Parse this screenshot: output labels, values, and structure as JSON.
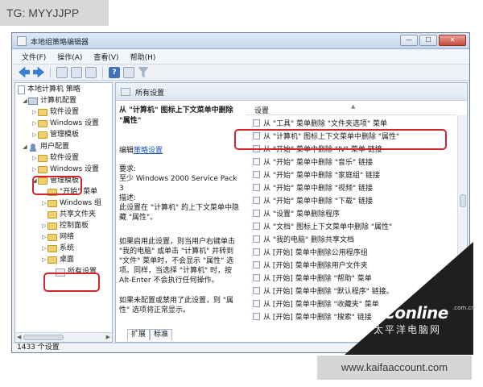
{
  "overlay": {
    "tag_text": "TG: MYYJJPP",
    "footer_url": "www.kaifaaccount.com",
    "watermark_main": "PConline",
    "watermark_com": ".com.cn",
    "watermark_cn": "太平洋电脑网"
  },
  "window": {
    "title": "本地组策略编辑器",
    "min_symbol": "—",
    "max_symbol": "☐",
    "close_symbol": "✕"
  },
  "menu": [
    "文件(F)",
    "操作(A)",
    "查看(V)",
    "帮助(H)"
  ],
  "tree": {
    "root": "本地计算机 策略",
    "computer_config": "计算机配置",
    "cc_software": "软件设置",
    "cc_windows": "Windows 设置",
    "cc_admin": "管理模板",
    "user_config": "用户配置",
    "uc_software": "软件设置",
    "uc_windows": "Windows 设置",
    "uc_admin": "管理模板",
    "sub_start": "\"开始\" 菜单",
    "sub_windows": "Windows 组",
    "sub_shared": "共享文件夹",
    "sub_control": "控制面板",
    "sub_network": "网络",
    "sub_system": "系统",
    "sub_desktop": "桌面",
    "sub_all": "所有设置",
    "expand_open": "◢",
    "expand_closed": "▷"
  },
  "right_header": "所有设置",
  "description": {
    "title": "从 \"计算机\" 图标上下文菜单中删除 \"属性\"",
    "edit_prefix": "编辑",
    "edit_link": "策略设置",
    "requirement": "要求:\n至少 Windows 2000 Service Pack 3",
    "desc_label": "描述:",
    "desc_text": "此设置在 \"计算机\" 的上下文菜单中隐藏 \"属性\"。",
    "para1": "如果启用此设置，则当用户右键单击 \"我的电脑\" 或单击 \"计算机\" 并转到 \"文件\" 菜单时，不会显示 \"属性\" 选项。同样，当选择 \"计算机\" 时，按 Alt-Enter 不会执行任何操作。",
    "para2": "如果未配置或禁用了此设置，则 \"属性\" 选项将正常显示。"
  },
  "list": {
    "header": "设置",
    "sorter": "▲",
    "rows": [
      "从 \"工具\" 菜单删除 \"文件夹选项\" 菜单",
      "从 \"计算机\" 图标上下文菜单中删除 \"属性\"",
      "从 \"开始\" 菜单中删除 \"IV\" 菜单 链接",
      "从 \"开始\" 菜单中删除 \"音乐\" 链接",
      "从 \"开始\" 菜单中删除 \"家庭组\" 链接",
      "从 \"开始\" 菜单中删除 \"视频\" 链接",
      "从 \"开始\" 菜单中删除 \"下载\" 链接",
      "从 \"设置\" 菜单删除程序",
      "从 \"文档\" 图标上下文菜单中删除 \"属性\"",
      "从 \"我的电脑\" 删除共享文档",
      "从 [开始] 菜单中删除公用程序组",
      "从 [开始] 菜单中删除用户文件夹",
      "从 [开始] 菜单中删除 \"帮助\" 菜单",
      "从 [开始] 菜单中删除 \"默认程序\" 链接。",
      "从 [开始] 菜单中删除 \"收藏夹\" 菜单",
      "从 [开始] 菜单中删除 \"搜索\" 链接"
    ]
  },
  "tabs": [
    "扩展",
    "标准"
  ],
  "status": "1433 个设置"
}
